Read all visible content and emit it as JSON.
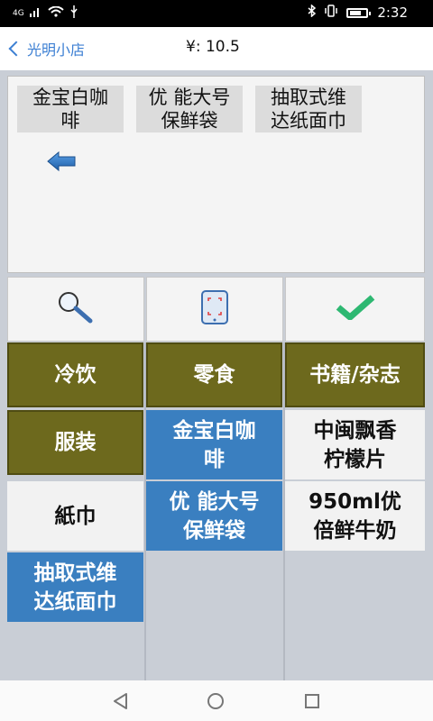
{
  "status_bar": {
    "network": "4G",
    "time": "2:32"
  },
  "header": {
    "back_label": "光明小店",
    "total": "¥: 10.5"
  },
  "cart": {
    "items": [
      {
        "line1": "金宝白咖",
        "line2": "啡"
      },
      {
        "line1": "优 能大号",
        "line2": "保鲜袋"
      },
      {
        "line1": "抽取式维",
        "line2": "达纸面巾"
      }
    ],
    "remove_icon": "left-arrow-icon"
  },
  "toolbar": {
    "search_icon": "magnifier-icon",
    "scan_icon": "scan-icon",
    "confirm_icon": "checkmark-icon"
  },
  "categories": [
    {
      "label": "冷饮"
    },
    {
      "label": "零食"
    },
    {
      "label": "书籍/杂志"
    },
    {
      "label": "服装"
    },
    {
      "label": "紙巾"
    }
  ],
  "products": [
    {
      "line1": "金宝白咖",
      "line2": "啡",
      "selected": true
    },
    {
      "line1": "中闽飘香",
      "line2": "柠檬片",
      "selected": false
    },
    {
      "line1": "优 能大号",
      "line2": "保鲜袋",
      "selected": true
    },
    {
      "line1": "950ml优",
      "line2": "倍鲜牛奶",
      "selected": false
    },
    {
      "line1": "抽取式维",
      "line2": "达纸面巾",
      "selected": true
    }
  ],
  "colors": {
    "accent": "#3c7fd3",
    "category_bg": "#6d691d",
    "selected_bg": "#3a7fc0",
    "check_green": "#2eb872"
  }
}
